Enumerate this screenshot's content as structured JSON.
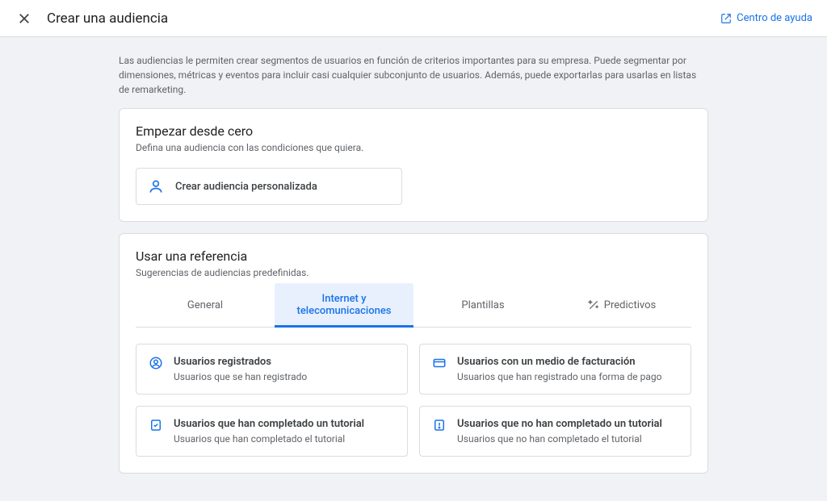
{
  "header": {
    "title": "Crear una audiencia",
    "help_label": "Centro de ayuda"
  },
  "intro": "Las audiencias le permiten crear segmentos de usuarios en función de criterios importantes para su empresa. Puede segmentar por dimensiones, métricas y eventos para incluir casi cualquier subconjunto de usuarios. Además, puede exportarlas para usarlas en listas de remarketing.",
  "panel_from_scratch": {
    "title": "Empezar desde cero",
    "subtitle": "Defina una audiencia con las condiciones que quiera.",
    "create_label": "Crear audiencia personalizada"
  },
  "panel_reference": {
    "title": "Usar una referencia",
    "subtitle": "Sugerencias de audiencias predefinidas."
  },
  "tabs": [
    {
      "label": "General"
    },
    {
      "label": "Internet y telecomunicaciones"
    },
    {
      "label": "Plantillas"
    },
    {
      "label": "Predictivos"
    }
  ],
  "cards": [
    {
      "title": "Usuarios registrados",
      "sub": "Usuarios que se han registrado"
    },
    {
      "title": "Usuarios con un medio de facturación",
      "sub": "Usuarios que han registrado una forma de pago"
    },
    {
      "title": "Usuarios que han completado un tutorial",
      "sub": "Usuarios que han completado el tutorial"
    },
    {
      "title": "Usuarios que no han completado un tutorial",
      "sub": "Usuarios que no han completado el tutorial"
    }
  ]
}
